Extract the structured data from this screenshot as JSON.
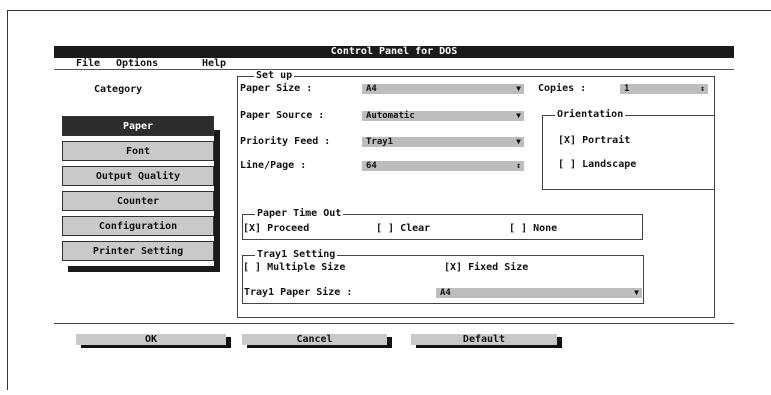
{
  "window": {
    "title": "Control Panel for DOS"
  },
  "menu": [
    "File",
    "Options",
    "Help"
  ],
  "category": {
    "heading": "Category",
    "items": [
      "Paper",
      "Font",
      "Output Quality",
      "Counter",
      "Configuration",
      "Printer Setting"
    ],
    "selected": "Paper"
  },
  "setup": {
    "legend": "Set up",
    "paper_size": {
      "label": "Paper Size :",
      "value": "A4"
    },
    "paper_source": {
      "label": "Paper Source :",
      "value": "Automatic"
    },
    "priority_feed": {
      "label": "Priority Feed :",
      "value": "Tray1"
    },
    "line_page": {
      "label": "Line/Page :",
      "value": "64"
    },
    "copies": {
      "label": "Copies :",
      "value": "1"
    }
  },
  "orientation": {
    "legend": "Orientation",
    "portrait": "[X] Portrait",
    "landscape": "[ ] Landscape"
  },
  "paper_timeout": {
    "legend": "Paper Time Out",
    "proceed": "[X] Proceed",
    "clear": "[ ] Clear",
    "none": "[ ] None"
  },
  "tray_setting": {
    "legend": "Tray1 Setting",
    "multiple": "[ ] Multiple Size",
    "fixed": "[X] Fixed Size",
    "paper_size_label": "Tray1 Paper Size :",
    "paper_size_value": "A4"
  },
  "buttons": {
    "ok": "OK",
    "cancel": "Cancel",
    "default": "Default"
  }
}
